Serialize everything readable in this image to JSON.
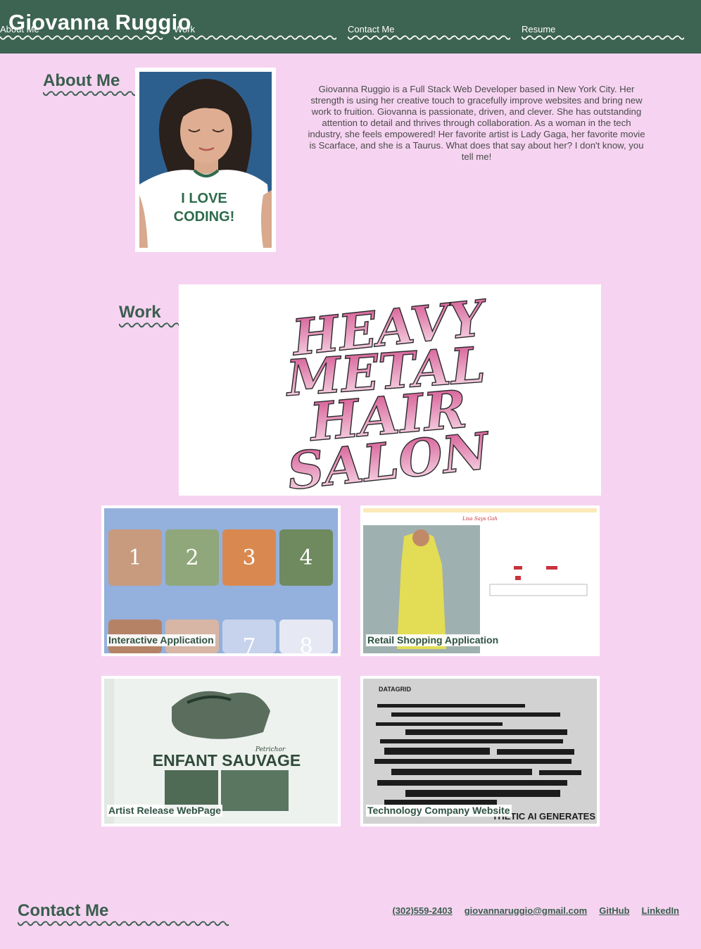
{
  "header": {
    "site_title": "Giovanna Ruggio",
    "nav": [
      "About Me",
      "Work",
      "Contact Me",
      "Resume"
    ]
  },
  "about": {
    "heading": "About Me",
    "portrait_text": "I LOVE CODING!",
    "bio": "Giovanna Ruggio is a Full Stack Web Developer based in New York City. Her strength is using her creative touch to gracefully improve websites and bring new work to fruition. Giovanna is passionate, driven, and clever. She has outstanding attention to detail and thrives through collaboration. As a woman in the tech industry, she feels empowered! Her favorite artist is Lady Gaga, her favorite movie is Scarface, and she is a Taurus. What does that say about her? I don't know, you tell me!"
  },
  "work": {
    "heading": "Work",
    "hero_lines": [
      "HEAVY",
      "METAL",
      "HAIR",
      "SALON"
    ],
    "projects": [
      {
        "label": "Interactive Application",
        "numbers": [
          "1",
          "2",
          "3",
          "4",
          "7",
          "8"
        ]
      },
      {
        "label": "Retail Shopping Application",
        "brand": "Lisa Says Gah"
      },
      {
        "label": "Artist Release WebPage",
        "title": "ENFANT SAUVAGE",
        "subtitle": "Petrichor"
      },
      {
        "label": "Technology Company Website",
        "brand": "DATAGRID",
        "tagline": "THETIC AI GENERATES"
      }
    ]
  },
  "contact": {
    "heading": "Contact Me",
    "phone": "(302)559-2403",
    "email": "giovannaruggio@gmail.com",
    "github": "GitHub",
    "linkedin": "LinkedIn"
  },
  "colors": {
    "background": "#f6d4f1",
    "header": "#3d6352",
    "heading_text": "#3a5e4e",
    "accent_pink": "#d9689e"
  }
}
